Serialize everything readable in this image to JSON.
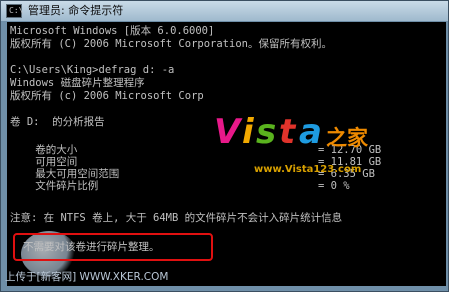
{
  "window": {
    "title": "管理员: 命令提示符",
    "icon_text": "C:\\"
  },
  "console": {
    "lines": [
      "Microsoft Windows [版本 6.0.6000]",
      "版权所有 (C) 2006 Microsoft Corporation。保留所有权利。",
      "C:\\Users\\King>defrag d: -a",
      "Windows 磁盘碎片整理程序",
      "版权所有 (c) 2006 Microsoft Corp",
      "卷 D:  的分析报告",
      "    卷的大小",
      "    可用空间",
      "    最大可用空间范围",
      "    文件碎片比例",
      "注意: 在 NTFS 卷上, 大于 64MB 的文件碎片不会计入碎片统计信息",
      "不需要对该卷进行碎片整理。"
    ],
    "values": [
      "= 12.70 GB",
      "= 11.81 GB",
      "= 6.35 GB",
      "= 0 %"
    ]
  },
  "watermark": {
    "letters": [
      "V",
      "i",
      "s",
      "t",
      "a"
    ],
    "suffix": "之家",
    "url": "www.Vista123.com",
    "bottom": "上传于[新客网] WWW.XKER.COM"
  },
  "colors": {
    "console_text": "#c0c0c0",
    "highlight_box": "#e01010"
  }
}
